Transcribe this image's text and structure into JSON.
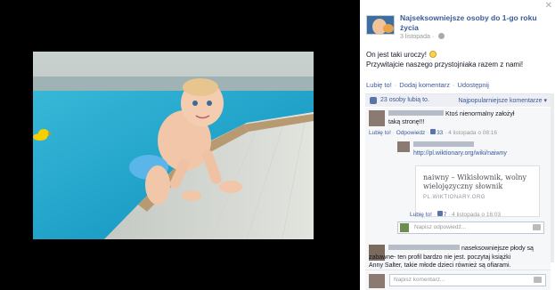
{
  "post": {
    "page_name": "Najseksowniejsze osoby do 1-go roku życia",
    "date": "3 listopada",
    "caption_line1": "On jest taki uroczy!",
    "caption_line2": "Przywitajcie naszego przystojniaka razem z nami!",
    "actions": {
      "like": "Lubię to!",
      "comment": "Dodaj komentarz",
      "share": "Udostępnij"
    }
  },
  "likes": {
    "count_text": "23 osoby lubią to.",
    "sort_label": "Najpopularniejsze komentarze ▾"
  },
  "comments": [
    {
      "text_line1": "Ktoś nienormalny założył",
      "text_line2": "taką stronę!!!",
      "like_label": "Lubię to!",
      "reply_label": "Odpowiedz",
      "likes": "33",
      "time": "4 listopada o 08:16"
    },
    {
      "link_url": "http://pl.wiktionary.org/wiki/naiwny",
      "link_title": "naiwny – Wikisłownik, wolny wielojęzyczny słownik",
      "link_domain": "PL.WIKTIONARY.ORG",
      "like_label": "Lubię to!",
      "likes": "7",
      "time": "4 listopada o 16:03"
    },
    {
      "text_line1": "naseksowniejsze płody są",
      "text_line2": "zabawne- ten profil bardzo nie jest. poczytaj książki",
      "text_line3": "Anny Salter, takie młode dzieci również są ofiarami."
    }
  ],
  "reply_placeholder": "Napisz odpowiedź...",
  "comment_placeholder": "Napisz komentarz...",
  "close_label": "✕",
  "icons": [
    "close-icon",
    "globe-icon",
    "smiley-icon",
    "like-icon",
    "camera-icon"
  ],
  "colors": {
    "link": "#3b5998",
    "panel_bg": "#ffffff",
    "comments_bg": "#f6f7f9",
    "stage_bg": "#000000"
  }
}
